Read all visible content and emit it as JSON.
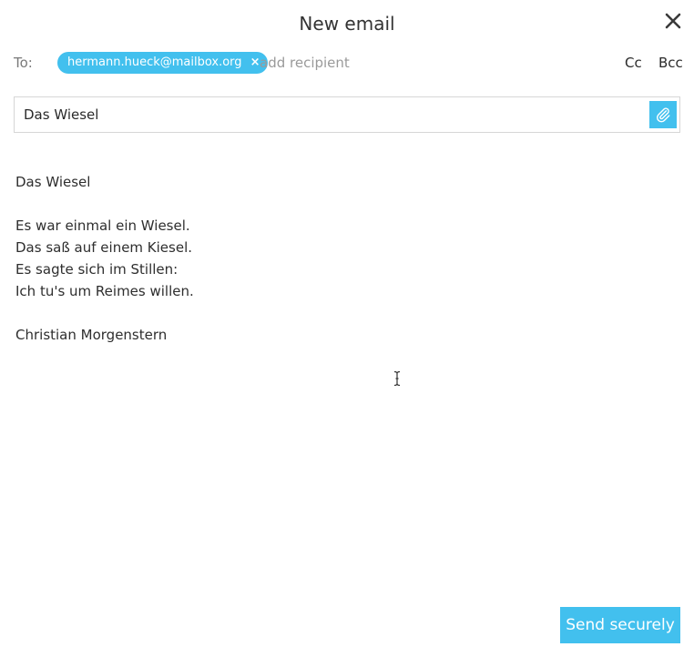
{
  "window": {
    "title": "New email",
    "close_icon": "close-icon"
  },
  "recipients": {
    "to_label": "To:",
    "chips": [
      {
        "email": "hermann.hueck@mailbox.org",
        "remove_symbol": "×"
      }
    ],
    "add_placeholder": "add recipient",
    "cc_label": "Cc",
    "bcc_label": "Bcc"
  },
  "subject": {
    "value": "Das Wiesel",
    "attach_icon": "paperclip-icon"
  },
  "body": {
    "lines": [
      "Das Wiesel",
      "",
      "Es war einmal ein Wiesel.",
      "Das saß auf einem Kiesel.",
      "Es sagte sich im Stillen:",
      "Ich tu's um Reimes willen.",
      "",
      "Christian Morgenstern"
    ]
  },
  "actions": {
    "send_label": "Send securely"
  },
  "colors": {
    "accent": "#42c0ee",
    "text": "#2f2f2f",
    "muted": "#9a9a9a",
    "border": "#d6d6d6"
  }
}
